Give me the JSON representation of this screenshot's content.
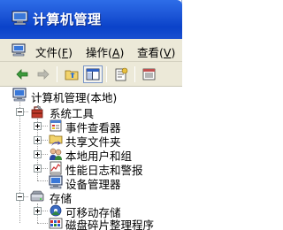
{
  "window": {
    "title": "计算机管理"
  },
  "menu": {
    "items": [
      {
        "label": "文件",
        "key": "F"
      },
      {
        "label": "操作",
        "key": "A"
      },
      {
        "label": "查看",
        "key": "V"
      }
    ]
  },
  "toolbar": {
    "buttons": [
      "back-arrow-icon",
      "forward-arrow-icon",
      "up-folder-icon",
      "show-hide-tree-icon",
      "properties-icon",
      "export-list-icon"
    ]
  },
  "tree": {
    "root": "计算机管理(本地)",
    "system_tools": {
      "label": "系统工具",
      "children": [
        "事件查看器",
        "共享文件夹",
        "本地用户和组",
        "性能日志和警报",
        "设备管理器"
      ]
    },
    "storage": {
      "label": "存储",
      "children": [
        "可移动存储",
        "磁盘碎片整理程序"
      ]
    }
  }
}
